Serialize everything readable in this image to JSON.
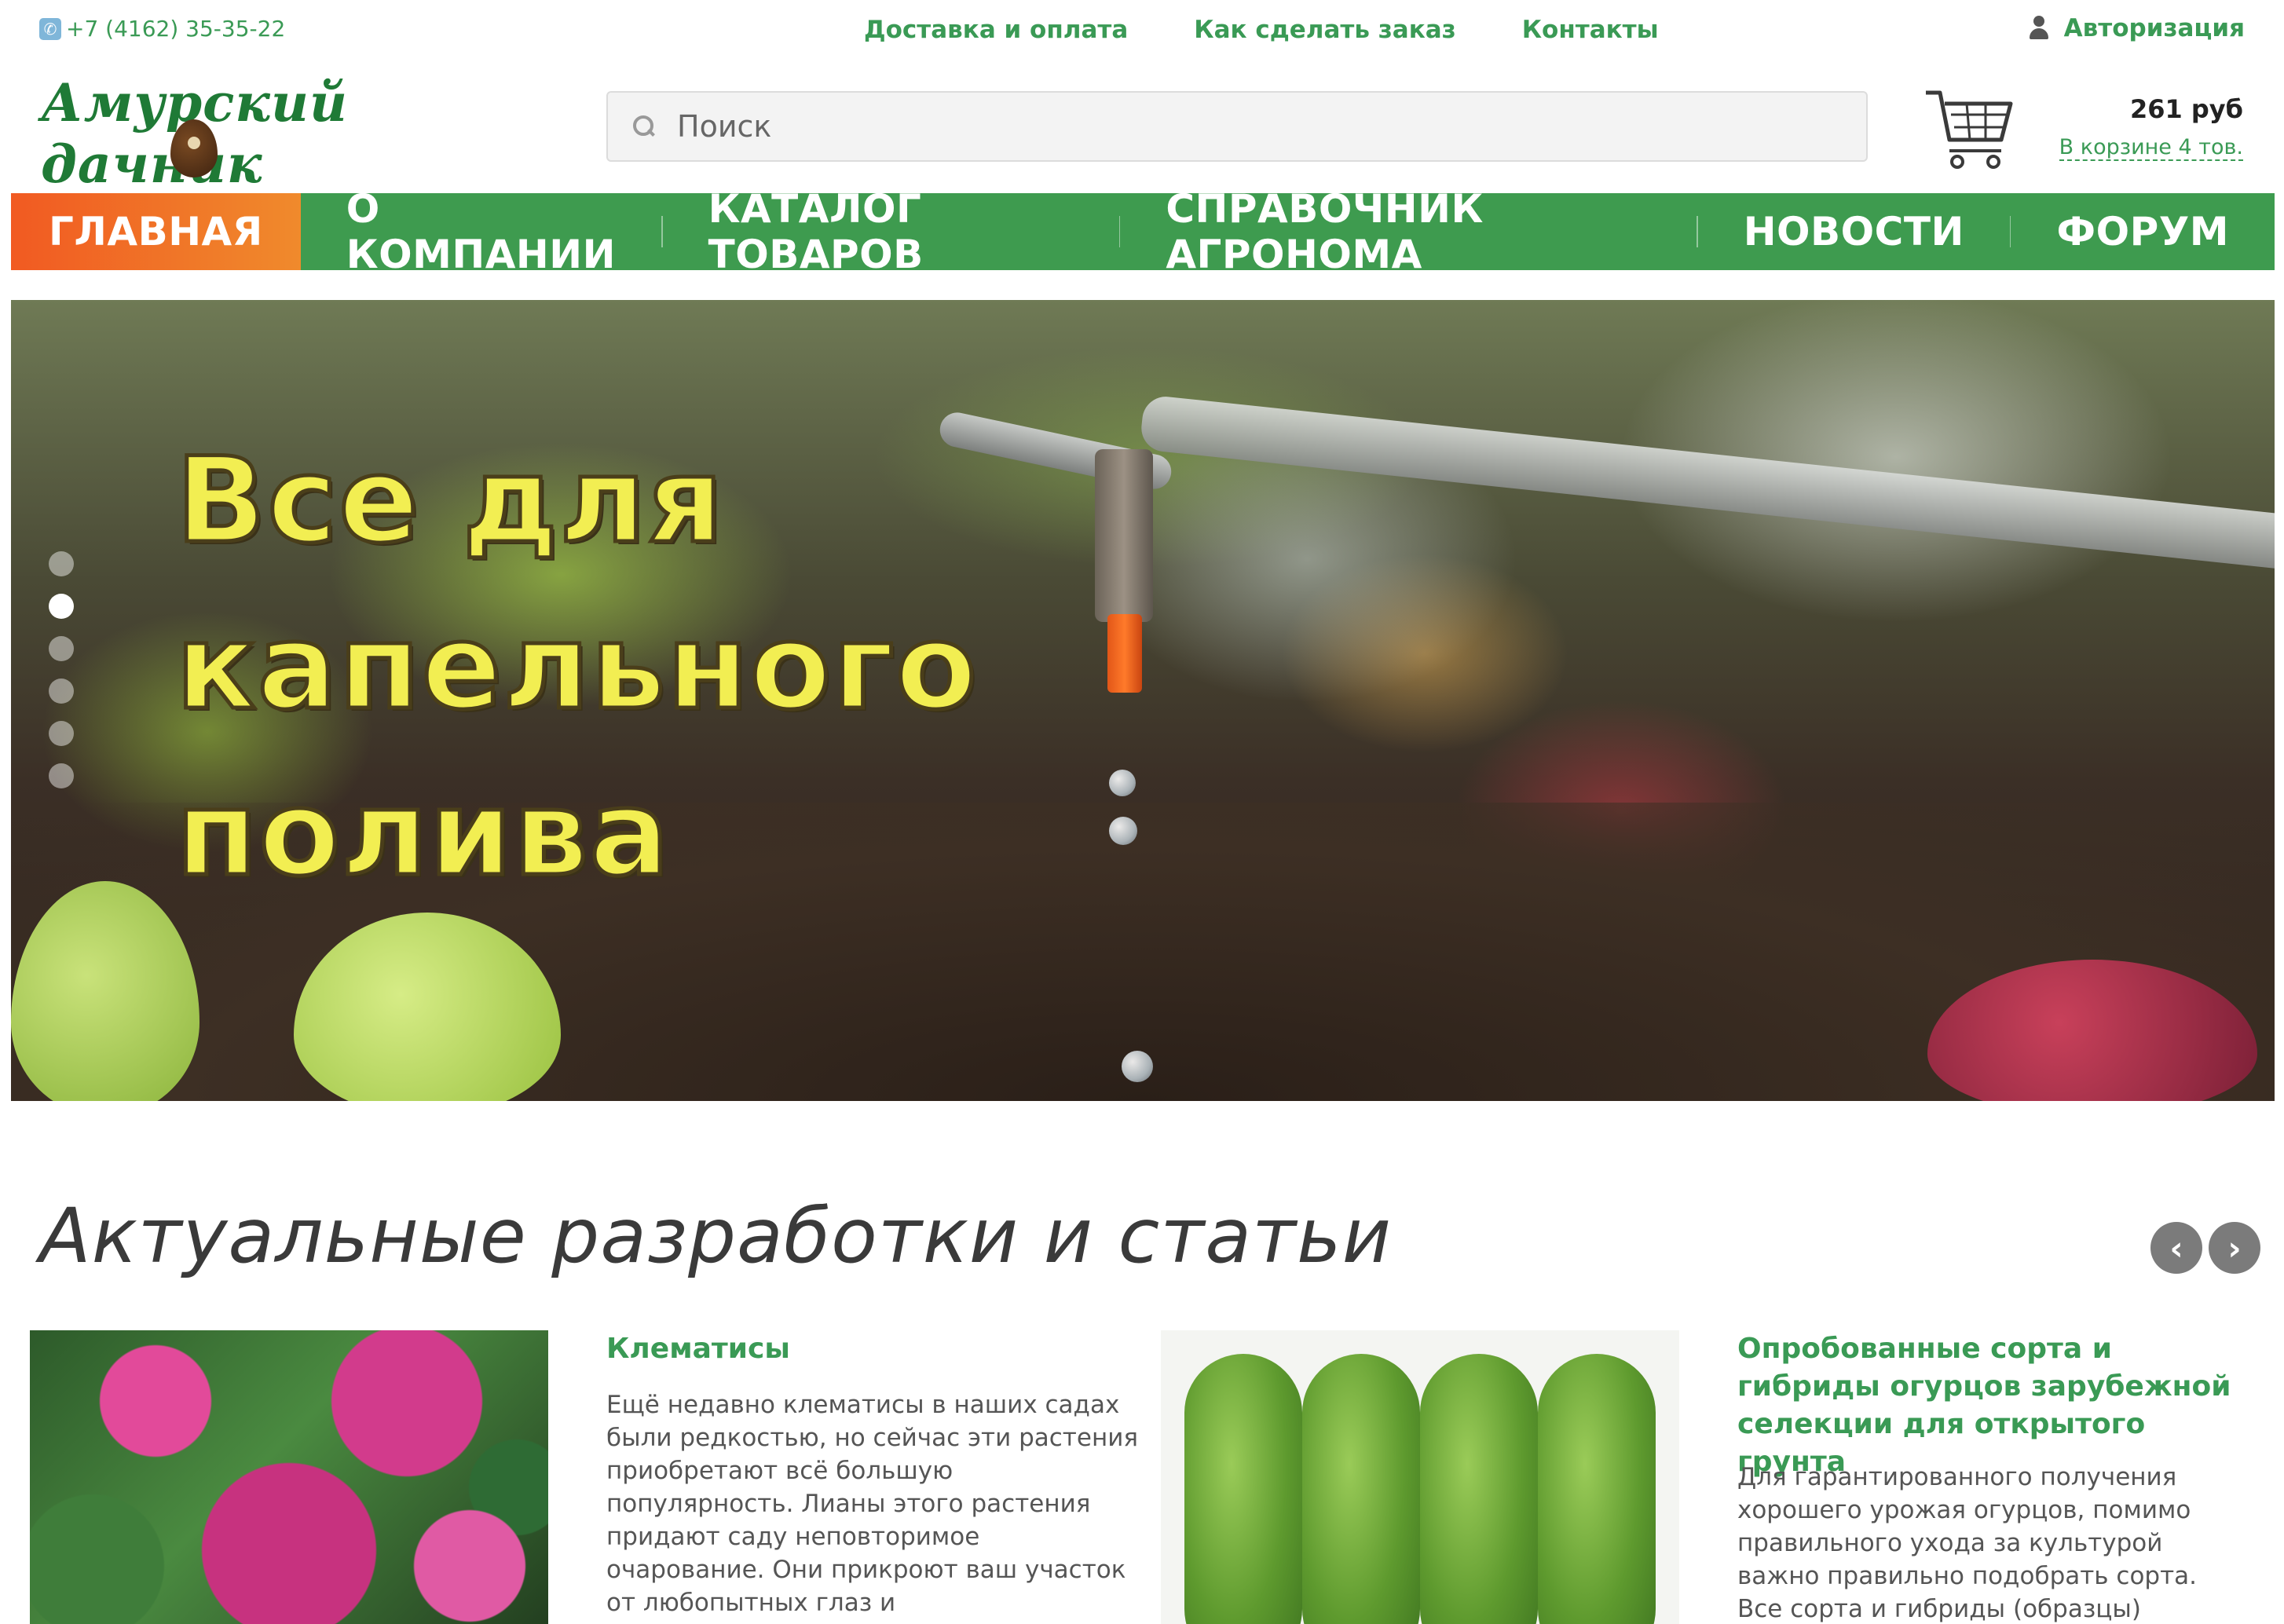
{
  "topbar": {
    "phone": "+7 (4162) 35-35-22",
    "links": [
      "Доставка и оплата",
      "Как сделать заказ",
      "Контакты"
    ],
    "auth_label": "Авторизация"
  },
  "header": {
    "logo_text": "Амурский дачник",
    "search_placeholder": "Поиск",
    "cart_sum": "261 руб",
    "cart_count": "В корзине 4 тов."
  },
  "menu": {
    "items": [
      "ГЛАВНАЯ",
      "О КОМПАНИИ",
      "КАТАЛОГ ТОВАРОВ",
      "СПРАВОЧНИК АГРОНОМА",
      "НОВОСТИ",
      "ФОРУМ"
    ],
    "active_index": 0
  },
  "hero": {
    "headline_lines": [
      "Все для",
      "капельного",
      "полива"
    ],
    "slide_count": 6,
    "active_slide": 1
  },
  "articles": {
    "section_title": "Актуальные разработки и статьи",
    "items": [
      {
        "title": "Клематисы",
        "text": "Ещё недавно клематисы в наших садах были редкостью, но сейчас эти растения приобретают всё большую популярность. Лианы этого растения придают саду неповторимое очарование. Они прикроют ваш участок от любопытных глаз и"
      },
      {
        "title": "Опробованные сорта и гибриды огурцов зарубежной селекции для открытого грунта",
        "text": "Для гарантированного получения хорошего урожая огурцов, помимо правильного ухода за культурой важно правильно подобрать сорта. Все сорта и гибриды (образцы)"
      }
    ]
  },
  "colors": {
    "brand_green": "#3e9b4f",
    "active_orange": "#f15a22",
    "headline_yellow": "#f2ee52"
  }
}
